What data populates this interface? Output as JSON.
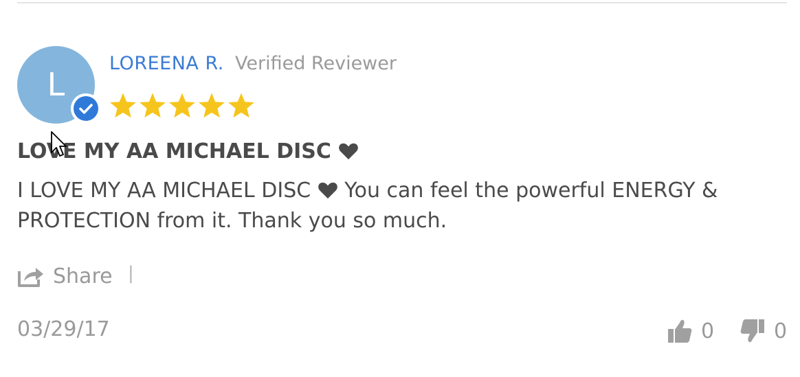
{
  "reviewer": {
    "initial": "L",
    "name": "LOREENA R.",
    "status": "Verified Reviewer",
    "avatar_color": "#84b6dd",
    "badge_color": "#2f7ad9",
    "badge_icon": "checkmark-icon"
  },
  "rating": {
    "value": 5,
    "max": 5,
    "star_color": "#f6c51d"
  },
  "review": {
    "title": "LOVE MY AA MICHAEL DISC",
    "body_part1": "I LOVE MY AA MICHAEL DISC",
    "body_part2": " You can feel the powerful ENERGY & PROTECTION from it. Thank you so much.",
    "emoji": "heart-icon"
  },
  "actions": {
    "share_label": "Share",
    "separator": "|"
  },
  "meta": {
    "date": "03/29/17"
  },
  "votes": {
    "up": "0",
    "down": "0"
  },
  "colors": {
    "name": "#3a7bd5",
    "muted": "#9a9a9a",
    "text": "#4a4a4a"
  }
}
